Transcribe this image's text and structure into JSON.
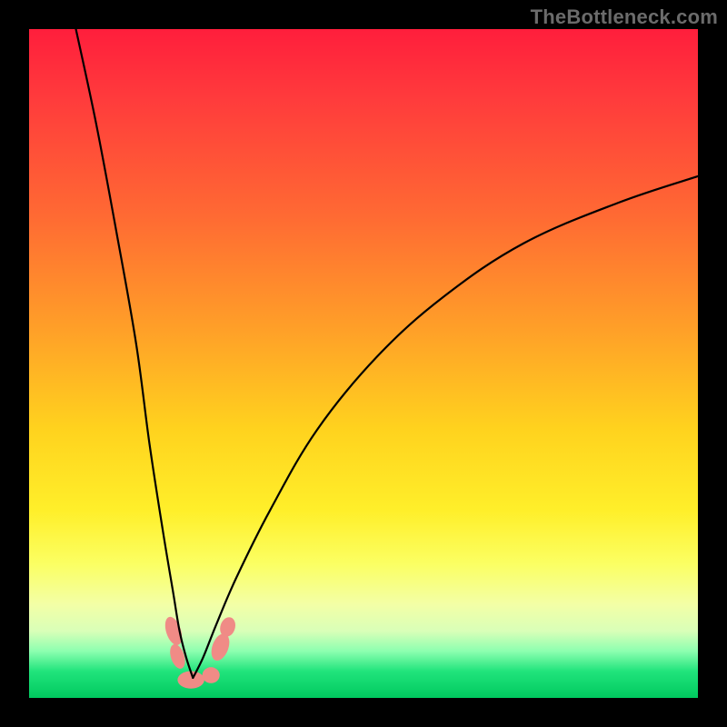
{
  "watermark": "TheBottleneck.com",
  "chart_data": {
    "type": "line",
    "title": "",
    "xlabel": "",
    "ylabel": "",
    "xlim": [
      0,
      100
    ],
    "ylim": [
      0,
      100
    ],
    "description": "Two black curves descending from the top toward a trough around x≈24, then one curve rises rightward. Background is a vertical rainbow gradient from red (top) through orange/yellow to green (bottom). Small salmon blobs cluster at/near the trough.",
    "series": [
      {
        "name": "left-curve",
        "x": [
          7,
          10,
          13,
          16,
          18,
          20,
          21.5,
          22.5,
          23.5,
          24.5
        ],
        "y": [
          100,
          86,
          70,
          53,
          38,
          25,
          16,
          10,
          6,
          3
        ]
      },
      {
        "name": "right-curve",
        "x": [
          24.5,
          26,
          28,
          31,
          36,
          43,
          52,
          62,
          74,
          88,
          100
        ],
        "y": [
          3,
          6,
          11,
          18,
          28,
          40,
          51,
          60,
          68,
          74,
          78
        ]
      }
    ],
    "blobs": [
      {
        "cx": 21.6,
        "cy": 10.0,
        "rx": 1.1,
        "ry": 2.2,
        "rot": -18
      },
      {
        "cx": 22.2,
        "cy": 6.2,
        "rx": 1.0,
        "ry": 1.9,
        "rot": -18
      },
      {
        "cx": 24.2,
        "cy": 2.7,
        "rx": 2.0,
        "ry": 1.3,
        "rot": 0
      },
      {
        "cx": 27.2,
        "cy": 3.4,
        "rx": 1.3,
        "ry": 1.2,
        "rot": 0
      },
      {
        "cx": 28.6,
        "cy": 7.6,
        "rx": 1.2,
        "ry": 2.1,
        "rot": 20
      },
      {
        "cx": 29.7,
        "cy": 10.6,
        "rx": 1.1,
        "ry": 1.5,
        "rot": 18
      }
    ],
    "gradient_stops": [
      {
        "pct": 0,
        "color": "#ff1e3c"
      },
      {
        "pct": 10,
        "color": "#ff3a3c"
      },
      {
        "pct": 28,
        "color": "#ff6a33"
      },
      {
        "pct": 45,
        "color": "#ffa028"
      },
      {
        "pct": 60,
        "color": "#ffd31e"
      },
      {
        "pct": 72,
        "color": "#ffef2a"
      },
      {
        "pct": 80,
        "color": "#fbff63"
      },
      {
        "pct": 86,
        "color": "#f3ffa6"
      },
      {
        "pct": 90,
        "color": "#d9ffb8"
      },
      {
        "pct": 93,
        "color": "#8dffb0"
      },
      {
        "pct": 96,
        "color": "#21e47c"
      },
      {
        "pct": 100,
        "color": "#00c95f"
      }
    ]
  }
}
